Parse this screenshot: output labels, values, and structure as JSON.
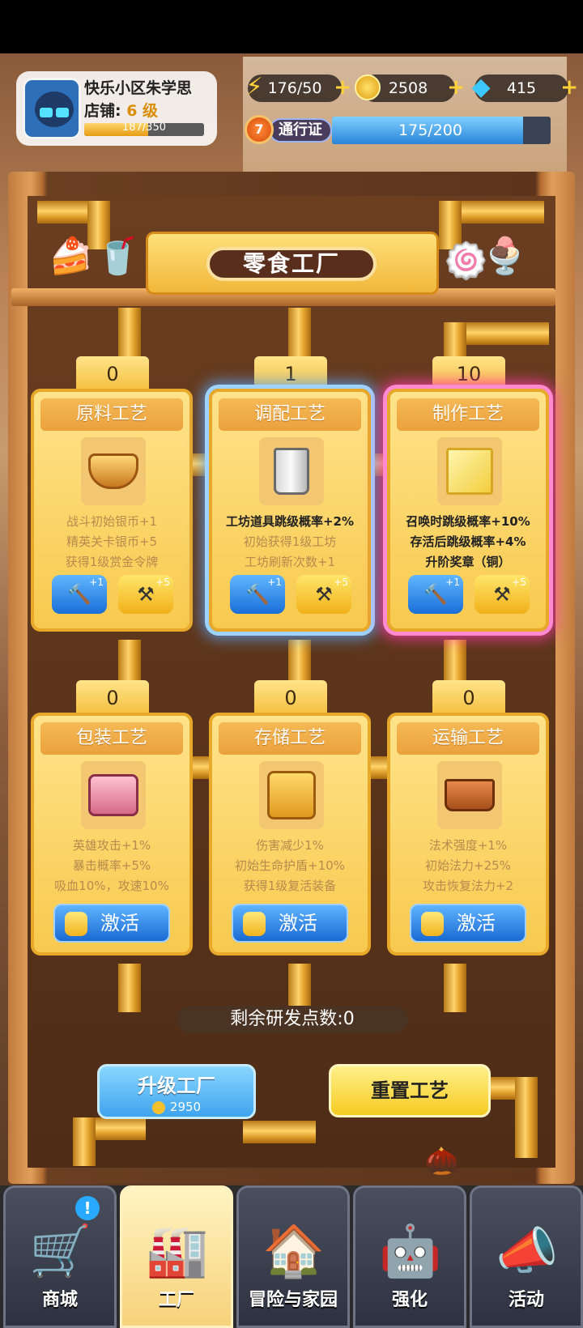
{
  "player": {
    "name": "快乐小区朱学思",
    "shop_prefix": "店铺: ",
    "shop_level": "6 级",
    "xp_text": "187/350",
    "xp_fraction": 0.534
  },
  "resources": [
    {
      "icon": "lightning-icon",
      "value": "176/50"
    },
    {
      "icon": "coin-icon",
      "value": "2508"
    },
    {
      "icon": "diamond-icon",
      "value": "415"
    }
  ],
  "pass": {
    "level": "7",
    "label": "通行证",
    "progress_text": "175/200",
    "progress_fraction": 0.875
  },
  "factory": {
    "title": "零食工厂"
  },
  "cards": [
    {
      "count": "0",
      "title": "原料工艺",
      "lines": [
        "战斗初始银币+1",
        "精英关卡银币+5",
        "获得1级赏金令牌"
      ],
      "up1": "+1",
      "up2": "+5"
    },
    {
      "count": "1",
      "title": "调配工艺",
      "lines": [
        "工坊道具跳级概率+2%",
        "初始获得1级工坊",
        "工坊刷新次数+1"
      ],
      "up1": "+1",
      "up2": "+5"
    },
    {
      "count": "10",
      "title": "制作工艺",
      "lines": [
        "召唤时跳级概率+10%",
        "存活后跳级概率+4%",
        "升阶奖章（铜）"
      ],
      "up1": "+1",
      "up2": "+5"
    },
    {
      "count": "0",
      "title": "包装工艺",
      "lines": [
        "英雄攻击+1%",
        "暴击概率+5%",
        "吸血10%，攻速10%"
      ],
      "action": "激活"
    },
    {
      "count": "0",
      "title": "存储工艺",
      "lines": [
        "伤害减少1%",
        "初始生命护盾+10%",
        "获得1级复活装备"
      ],
      "action": "激活"
    },
    {
      "count": "0",
      "title": "运输工艺",
      "lines": [
        "法术强度+1%",
        "初始法力+25%",
        "攻击恢复法力+2"
      ],
      "action": "激活"
    }
  ],
  "remaining_points": "剩余研发点数:0",
  "upgrade": {
    "label": "升级工厂",
    "cost": "2950"
  },
  "reset": {
    "label": "重置工艺"
  },
  "nav": [
    {
      "label": "商城",
      "icon": "shopping-cart-icon",
      "badge": "!"
    },
    {
      "label": "工厂",
      "icon": "factory-icon"
    },
    {
      "label": "冒险与家园",
      "icon": "adventure-icon"
    },
    {
      "label": "强化",
      "icon": "robot-icon"
    },
    {
      "label": "活动",
      "icon": "megaphone-icon"
    }
  ]
}
